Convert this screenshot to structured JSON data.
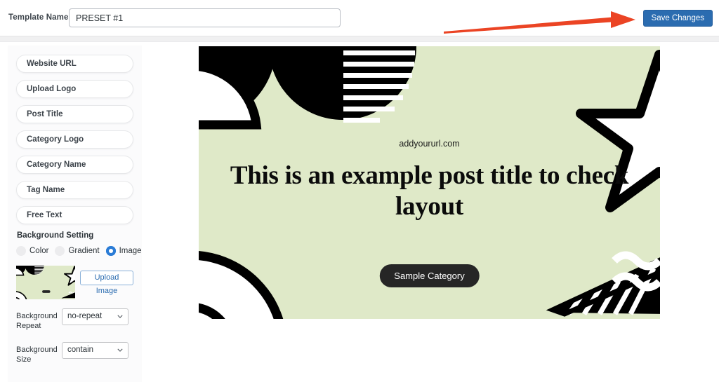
{
  "topbar": {
    "template_label": "Template Name",
    "template_value": "PRESET #1",
    "template_placeholder": "Template Name",
    "save_label": "Save Changes",
    "save_color": "#2b6cb0",
    "arrow_color": "#eb4424"
  },
  "sidebar": {
    "field_buttons": [
      {
        "label": "Website URL"
      },
      {
        "label": "Upload Logo"
      },
      {
        "label": "Post Title"
      },
      {
        "label": "Category Logo"
      },
      {
        "label": "Category Name"
      },
      {
        "label": "Tag Name"
      },
      {
        "label": "Free Text"
      }
    ],
    "background_setting": {
      "title": "Background Setting",
      "options": [
        {
          "label": "Color",
          "selected": false
        },
        {
          "label": "Gradient",
          "selected": false
        },
        {
          "label": "Image",
          "selected": true
        }
      ],
      "selected_color": "#2b7cd6",
      "upload_image_label": "Upload Image",
      "repeat_label": "Background Repeat",
      "repeat_value": "no-repeat",
      "size_label": "Background Size",
      "size_value": "contain"
    }
  },
  "canvas": {
    "background_color": "#dfe9c8",
    "url_text": "addyoururl.com",
    "title_text": "This is an example post title to check layout",
    "category_badge": "Sample Category",
    "badge_color": "#262626",
    "shape_color": "#000000",
    "shape_accent": "#ffffff"
  }
}
